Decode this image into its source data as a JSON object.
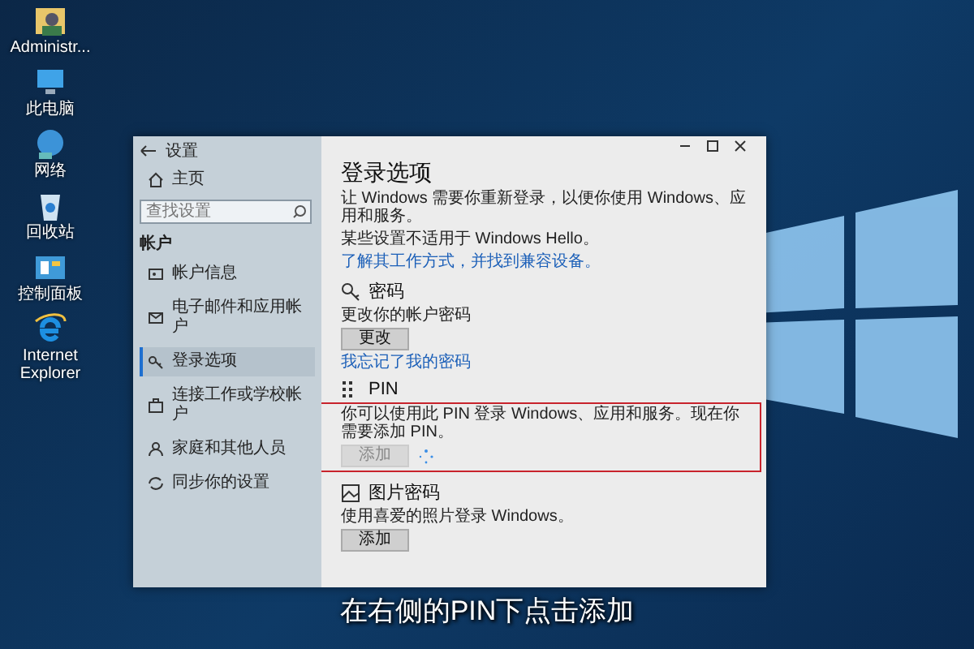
{
  "desktop_icons": [
    {
      "label": "Administr...",
      "kind": "user"
    },
    {
      "label": "此电脑",
      "kind": "pc"
    },
    {
      "label": "网络",
      "kind": "network"
    },
    {
      "label": "回收站",
      "kind": "bin"
    },
    {
      "label": "控制面板",
      "kind": "panel"
    },
    {
      "label": "Internet Explorer",
      "kind": "ie"
    }
  ],
  "window": {
    "title": "设置"
  },
  "sidebar": {
    "home": "主页",
    "search": {
      "placeholder": "查找设置"
    },
    "section": "帐户",
    "items": [
      {
        "label": "帐户信息",
        "kind": "info",
        "selected": false
      },
      {
        "label": "电子邮件和应用帐户",
        "kind": "mail",
        "selected": false
      },
      {
        "label": "登录选项",
        "kind": "key",
        "selected": true
      },
      {
        "label": "连接工作或学校帐户",
        "kind": "work",
        "selected": false
      },
      {
        "label": "家庭和其他人员",
        "kind": "family",
        "selected": false
      },
      {
        "label": "同步你的设置",
        "kind": "sync",
        "selected": false
      }
    ]
  },
  "main": {
    "title": "登录选项",
    "description": "让 Windows 需要你重新登录，以便你使用 Windows、应用和服务。",
    "notice": "某些设置不适用于 Windows Hello。",
    "link": "了解其工作方式，并找到兼容设备。",
    "sections": [
      {
        "kind": "password",
        "heading": "密码",
        "text": "更改你的帐户密码",
        "button": {
          "label": "更改",
          "disabled": false
        },
        "link": "我忘记了我的密码",
        "loading": false,
        "highlighted": false
      },
      {
        "kind": "pin",
        "heading": "PIN",
        "text": "你可以使用此 PIN 登录 Windows、应用和服务。现在你需要添加 PIN。",
        "button": {
          "label": "添加",
          "disabled": true
        },
        "loading": true,
        "highlighted": true
      },
      {
        "kind": "picture",
        "heading": "图片密码",
        "text": "使用喜爱的照片登录 Windows。",
        "button": {
          "label": "添加",
          "disabled": false
        },
        "loading": false,
        "highlighted": false
      }
    ]
  },
  "caption": "在右侧的PIN下点击添加"
}
